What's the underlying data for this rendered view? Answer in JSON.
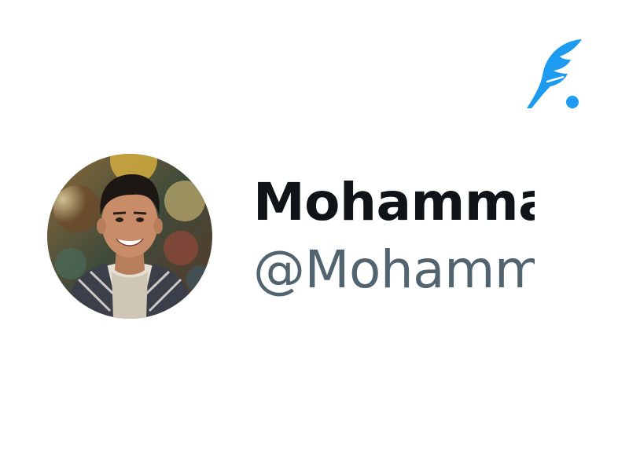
{
  "profile": {
    "display_name": "Mohammad",
    "handle": "@Mohammad",
    "avatar_icon": "profile-photo",
    "avatar_alt": ""
  },
  "brand": {
    "logo_icon": "feather-quill-logo",
    "accent_color": "#1d9bf0"
  },
  "colors": {
    "name_color": "#0f1419",
    "handle_color": "#536471",
    "background": "#ffffff"
  }
}
